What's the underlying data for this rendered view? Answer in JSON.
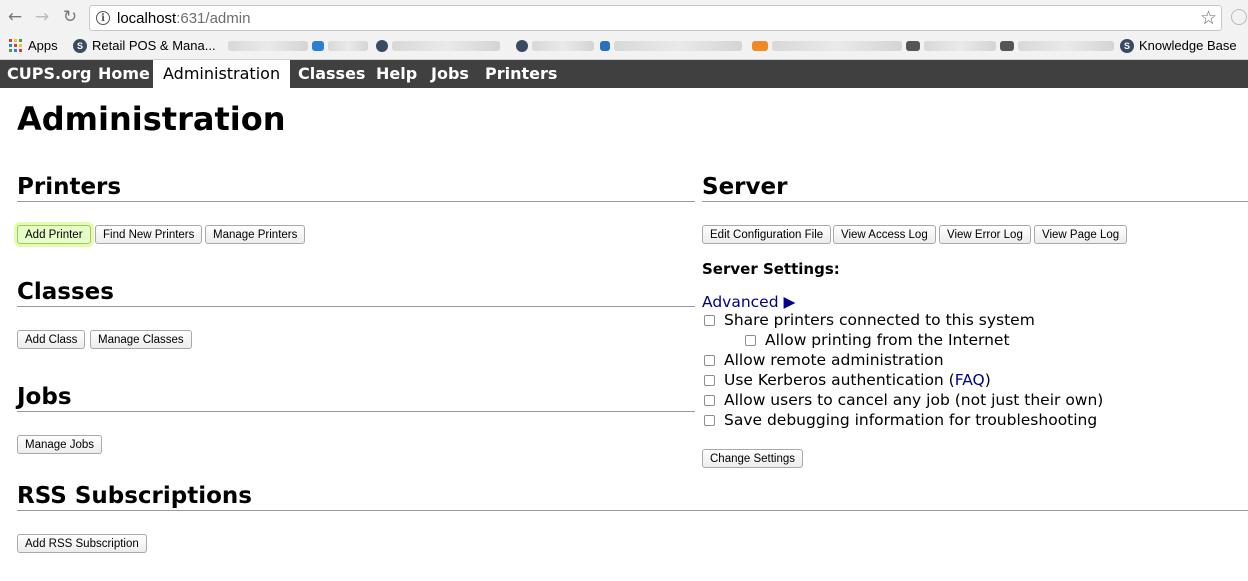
{
  "browser": {
    "url_host": "localhost",
    "url_path": ":631/admin",
    "bookmarks": {
      "apps": "Apps",
      "retail": "Retail POS & Mana...",
      "kb": "Knowledge Base"
    }
  },
  "nav": {
    "brand": "CUPS.org",
    "home": "Home",
    "administration": "Administration",
    "classes": "Classes",
    "help": "Help",
    "jobs": "Jobs",
    "printers": "Printers"
  },
  "page": {
    "title": "Administration"
  },
  "printers": {
    "heading": "Printers",
    "add_printer": "Add Printer",
    "find_new_printers": "Find New Printers",
    "manage_printers": "Manage Printers"
  },
  "classes": {
    "heading": "Classes",
    "add_class": "Add Class",
    "manage_classes": "Manage Classes"
  },
  "jobs": {
    "heading": "Jobs",
    "manage_jobs": "Manage Jobs"
  },
  "rss": {
    "heading": "RSS Subscriptions",
    "add_rss": "Add RSS Subscription"
  },
  "server": {
    "heading": "Server",
    "edit_config": "Edit Configuration File",
    "view_access_log": "View Access Log",
    "view_error_log": "View Error Log",
    "view_page_log": "View Page Log",
    "settings_heading": "Server Settings:",
    "advanced": "Advanced ▶",
    "share_printers": "Share printers connected to this system",
    "allow_internet": "Allow printing from the Internet",
    "remote_admin": "Allow remote administration",
    "kerberos_pre": "Use Kerberos authentication (",
    "kerberos_faq": "FAQ",
    "kerberos_post": ")",
    "cancel_any_job": "Allow users to cancel any job (not just their own)",
    "debug_logging": "Save debugging information for troubleshooting",
    "change_settings": "Change Settings"
  }
}
